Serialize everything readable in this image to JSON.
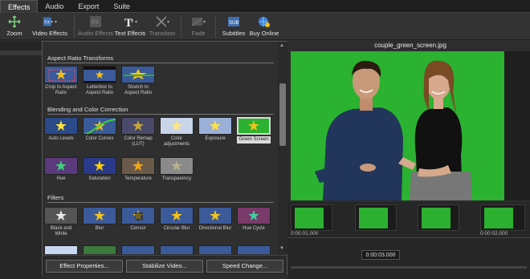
{
  "tabs": [
    {
      "label": "Effects",
      "active": true
    },
    {
      "label": "Audio"
    },
    {
      "label": "Export"
    },
    {
      "label": "Suite"
    }
  ],
  "toolbar": [
    {
      "label": "Zoom",
      "icon": "zoom-icon",
      "enabled": true
    },
    {
      "label": "Video Effects",
      "icon": "fx-icon",
      "enabled": true,
      "dropdown": true
    },
    {
      "label": "Audio Effects",
      "icon": "audio-fx-icon",
      "enabled": false
    },
    {
      "label": "Text Effects",
      "icon": "text-fx-icon",
      "enabled": true,
      "dropdown": true
    },
    {
      "label": "Transition",
      "icon": "transition-icon",
      "enabled": false,
      "dropdown": true
    },
    {
      "label": "Fade",
      "icon": "fade-icon",
      "enabled": false,
      "dropdown": true
    },
    {
      "label": "Subtitles",
      "icon": "subtitles-icon",
      "enabled": true
    },
    {
      "label": "Buy Online",
      "icon": "buy-online-icon",
      "enabled": true
    }
  ],
  "panel": {
    "sections": [
      {
        "title": "Aspect Ratio Transforms",
        "items": [
          "Crop to Aspect Ratio",
          "Letterbox to Aspect Ratio",
          "Stretch to Aspect Ratio"
        ]
      },
      {
        "title": "Blending and Color Correction",
        "items": [
          "Auto Levels",
          "Color Curves",
          "Color Remap (LUT)",
          "Color adjustments",
          "Exposure",
          "Green Screen",
          "Hue",
          "Saturation",
          "Temperature",
          "Transparency"
        ]
      },
      {
        "title": "Filters",
        "items": [
          "Black and White",
          "Blur",
          "Censor",
          "Circular Blur",
          "Directional Blur",
          "Hue Cycle"
        ]
      }
    ],
    "selected": "Green Screen",
    "buttons": [
      "Effect Properties...",
      "Stabilize Video...",
      "Speed Change..."
    ]
  },
  "preview": {
    "filename": "couple_green_screen.jpg"
  },
  "timeline": {
    "ticks": [
      "0:00:01.000",
      "0:00:02.000"
    ],
    "current_time": "0:00:03.000"
  },
  "colors": {
    "green_screen": "#2ab230",
    "accent_star": "#f2c21b",
    "panel_bg": "#2f2f2f"
  }
}
